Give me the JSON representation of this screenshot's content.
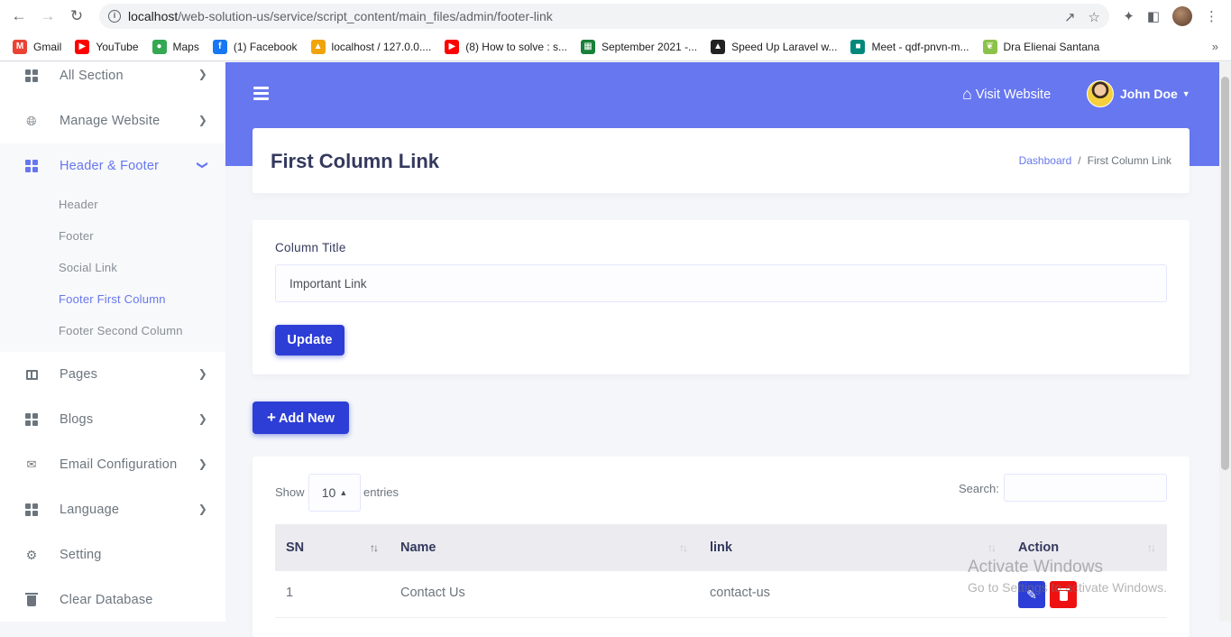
{
  "browser": {
    "url_host": "localhost",
    "url_path": "/web-solution-us/service/script_content/main_files/admin/footer-link",
    "bookmarks": [
      {
        "label": "Gmail",
        "color": "#ea4335",
        "icon": "gmail-icon",
        "glyph": "M"
      },
      {
        "label": "YouTube",
        "color": "#ff0000",
        "icon": "youtube-icon",
        "glyph": "▶"
      },
      {
        "label": "Maps",
        "color": "#34a853",
        "icon": "maps-icon",
        "glyph": "●"
      },
      {
        "label": "(1) Facebook",
        "color": "#1877f2",
        "icon": "facebook-icon",
        "glyph": "f"
      },
      {
        "label": "localhost / 127.0.0....",
        "color": "#f0a30a",
        "icon": "phpmyadmin-icon",
        "glyph": "▲"
      },
      {
        "label": "(8) How to solve : s...",
        "color": "#ff0000",
        "icon": "youtube-icon",
        "glyph": "▶"
      },
      {
        "label": "September 2021 -...",
        "color": "#188038",
        "icon": "sheets-icon",
        "glyph": "▦"
      },
      {
        "label": "Speed Up Laravel w...",
        "color": "#222222",
        "icon": "laravel-icon",
        "glyph": "▲"
      },
      {
        "label": "Meet - qdf-pnvn-m...",
        "color": "#00897b",
        "icon": "meet-icon",
        "glyph": "■"
      },
      {
        "label": "Dra Elienai Santana",
        "color": "#8bc34a",
        "icon": "leaf-icon",
        "glyph": "❦"
      }
    ]
  },
  "sidebar": {
    "items": [
      {
        "label": "All Section",
        "icon": "grid-icon"
      },
      {
        "label": "Manage Website",
        "icon": "globe-icon"
      },
      {
        "label": "Header & Footer",
        "icon": "grid-icon"
      }
    ],
    "submenu": [
      "Header",
      "Footer",
      "Social Link",
      "Footer First Column",
      "Footer Second Column"
    ],
    "items_after": [
      {
        "label": "Pages",
        "icon": "columns-icon"
      },
      {
        "label": "Blogs",
        "icon": "grid-icon"
      },
      {
        "label": "Email Configuration",
        "icon": "envelope-icon"
      },
      {
        "label": "Language",
        "icon": "grid-icon"
      },
      {
        "label": "Setting",
        "icon": "gear-icon"
      },
      {
        "label": "Clear Database",
        "icon": "trash-icon"
      }
    ]
  },
  "topbar": {
    "visit_label": "Visit Website",
    "user_name": "John Doe"
  },
  "page": {
    "title": "First Column Link",
    "breadcrumb_home": "Dashboard",
    "breadcrumb_sep": "/",
    "breadcrumb_current": "First Column Link"
  },
  "form": {
    "label": "Column Title",
    "value": "Important Link",
    "update_label": "Update"
  },
  "add_new_label": "Add New",
  "table": {
    "show_label": "Show",
    "page_size": "10",
    "entries_label": "entries",
    "search_label": "Search:",
    "columns": [
      "SN",
      "Name",
      "link",
      "Action"
    ],
    "rows": [
      {
        "sn": "1",
        "name": "Contact Us",
        "link": "contact-us"
      }
    ]
  },
  "watermark": {
    "line1": "Activate Windows",
    "line2": "Go to Settings to activate Windows."
  },
  "colors": {
    "accent": "#6777ef",
    "button": "#2d3ed6",
    "danger": "#ee1111"
  }
}
